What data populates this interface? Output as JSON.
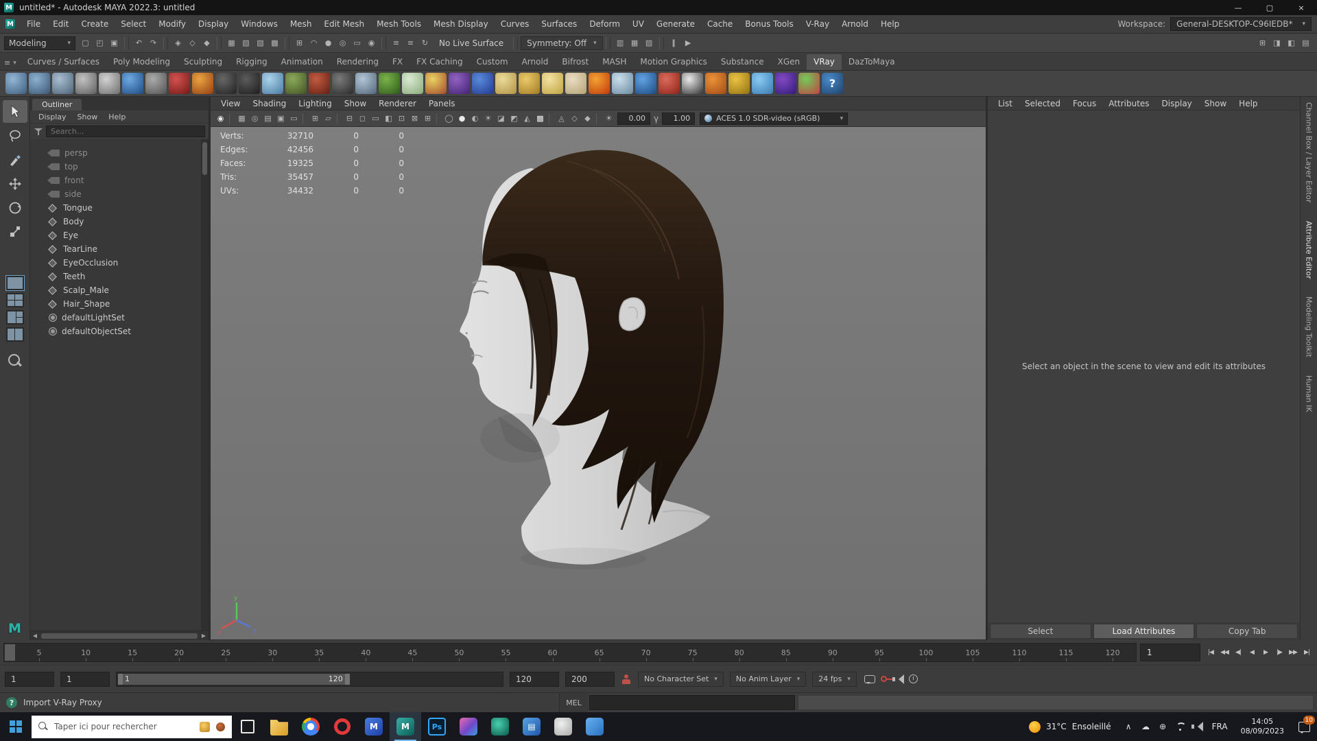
{
  "theme": {
    "accent": "#5285a6",
    "viewport_bg": "#787878",
    "hair_color": "#261b10",
    "skin_color": "#d6d6d6",
    "taskbar_bg": "#16181d"
  },
  "glyphs": {
    "caret": "▾",
    "menu": "≡",
    "gamma": "γ",
    "pause": "∥"
  },
  "titlebar": {
    "title": "untitled* - Autodesk MAYA 2022.3: untitled",
    "min": "—",
    "max": "▢",
    "close": "×"
  },
  "menubar": {
    "items": [
      "File",
      "Edit",
      "Create",
      "Select",
      "Modify",
      "Display",
      "Windows",
      "Mesh",
      "Edit Mesh",
      "Mesh Tools",
      "Mesh Display",
      "Curves",
      "Surfaces",
      "Deform",
      "UV",
      "Generate",
      "Cache",
      "Bonus Tools",
      "V-Ray",
      "Arnold",
      "Help"
    ],
    "workspace_label": "Workspace:",
    "workspace": "General-DESKTOP-C96IEDB*"
  },
  "statusline": {
    "mode": "Modeling",
    "live_surface": "No Live Surface",
    "symmetry": "Symmetry: Off",
    "icons": [
      {
        "cls": "sl-icon",
        "name": "new-scene-icon",
        "g": "▢"
      },
      {
        "cls": "sl-icon",
        "name": "open-scene-icon",
        "g": "◰"
      },
      {
        "cls": "sl-icon",
        "name": "save-scene-icon",
        "g": "▣"
      },
      {
        "cls": "sl-sep",
        "name": "separator",
        "g": ""
      },
      {
        "cls": "sl-icon",
        "name": "undo-icon",
        "g": "↶"
      },
      {
        "cls": "sl-icon",
        "name": "redo-icon",
        "g": "↷"
      },
      {
        "cls": "sl-sep",
        "name": "separator",
        "g": ""
      },
      {
        "cls": "sl-icon",
        "name": "select-by-hierarchy-icon",
        "g": "◈"
      },
      {
        "cls": "sl-icon",
        "name": "select-by-object-icon",
        "g": "◇"
      },
      {
        "cls": "sl-icon",
        "name": "select-by-component-icon",
        "g": "◆"
      },
      {
        "cls": "sl-sep",
        "name": "separator",
        "g": ""
      },
      {
        "cls": "sl-icon",
        "name": "mask-handles-icon",
        "g": "▦"
      },
      {
        "cls": "sl-icon",
        "name": "mask-joints-icon",
        "g": "▧"
      },
      {
        "cls": "sl-icon",
        "name": "mask-curves-icon",
        "g": "▨"
      },
      {
        "cls": "sl-icon",
        "name": "mask-surfaces-icon",
        "g": "▩"
      },
      {
        "cls": "sl-sep",
        "name": "separator",
        "g": ""
      },
      {
        "cls": "sl-icon",
        "name": "snap-to-grid-icon",
        "g": "⊞"
      },
      {
        "cls": "sl-icon",
        "name": "snap-to-curve-icon",
        "g": "◠"
      },
      {
        "cls": "sl-icon",
        "name": "snap-to-point-icon",
        "g": "●"
      },
      {
        "cls": "sl-icon",
        "name": "snap-to-projected-center-icon",
        "g": "◎"
      },
      {
        "cls": "sl-icon",
        "name": "snap-to-view-plane-icon",
        "g": "▭"
      },
      {
        "cls": "sl-icon",
        "name": "make-live-icon",
        "g": "◉"
      },
      {
        "cls": "sl-sep",
        "name": "separator",
        "g": ""
      },
      {
        "cls": "sl-icon",
        "name": "input-connections-icon",
        "g": "≡"
      },
      {
        "cls": "sl-icon",
        "name": "output-connections-icon",
        "g": "≡"
      },
      {
        "cls": "sl-icon",
        "name": "construction-history-icon",
        "g": "↻"
      }
    ],
    "icons2": [
      {
        "cls": "sl-icon",
        "name": "render-current-frame-icon",
        "g": "▥"
      },
      {
        "cls": "sl-icon",
        "name": "ipr-render-icon",
        "g": "▦"
      },
      {
        "cls": "sl-icon",
        "name": "render-settings-icon",
        "g": "▧"
      },
      {
        "cls": "sl-sep",
        "name": "separator",
        "g": ""
      },
      {
        "cls": "sl-icon pause",
        "name": "pause-evaluation-icon",
        "g": "∥"
      },
      {
        "cls": "sl-icon",
        "name": "resume-evaluation-icon",
        "g": "▶"
      }
    ],
    "right_icons": [
      {
        "cls": "sl-icon",
        "name": "toggle-modeling-toolkit-icon",
        "g": "⊞"
      },
      {
        "cls": "sl-icon",
        "name": "toggle-attribute-editor-icon",
        "g": "◨"
      },
      {
        "cls": "sl-icon",
        "name": "toggle-tool-settings-icon",
        "g": "◧"
      },
      {
        "cls": "sl-icon",
        "name": "toggle-channel-box-icon",
        "g": "▤"
      }
    ]
  },
  "shelf": {
    "tabs": [
      {
        "label": "Curves / Surfaces"
      },
      {
        "label": "Poly Modeling"
      },
      {
        "label": "Sculpting"
      },
      {
        "label": "Rigging"
      },
      {
        "label": "Animation"
      },
      {
        "label": "Rendering"
      },
      {
        "label": "FX"
      },
      {
        "label": "FX Caching"
      },
      {
        "label": "Custom"
      },
      {
        "label": "Arnold"
      },
      {
        "label": "Bifrost"
      },
      {
        "label": "MASH"
      },
      {
        "label": "Motion Graphics"
      },
      {
        "label": "Substance"
      },
      {
        "label": "XGen"
      },
      {
        "label": "VRay",
        "active": true
      },
      {
        "label": "DazToMaya"
      }
    ],
    "icons": [
      {
        "css": "--c1:#93b7d6;--c2:#3e5d7d",
        "name": "poly-tool-icon-1"
      },
      {
        "css": "--c1:#8db1d0;--c2:#3a5674",
        "name": "poly-tool-icon-2"
      },
      {
        "css": "--c1:#a9bfd0;--c2:#4c6378",
        "name": "plane-tool-icon"
      },
      {
        "css": "--c1:#c2c2c2;--c2:#5e5e5e",
        "name": "measure-tool-icon"
      },
      {
        "css": "--c1:#d2d2d2;--c2:#6e6e6e",
        "name": "notes-icon"
      },
      {
        "css": "--c1:#6fa9e1;--c2:#1d4b81",
        "name": "sphere-blue-icon"
      },
      {
        "css": "--c1:#ababab;--c2:#525252",
        "name": "sphere-gray-icon"
      },
      {
        "css": "--c1:#d25250;--c2:#721915",
        "name": "sphere-red-icon"
      },
      {
        "css": "--c1:#eaa342;--c2:#924112",
        "name": "sphere-orange-icon"
      },
      {
        "css": "--c1:#676767;--c2:#212121",
        "name": "checker-sphere-icon"
      },
      {
        "css": "--c1:#5b5b5b;--c2:#1d1d1d",
        "name": "dark-sphere-icon"
      },
      {
        "css": "--c1:#abd3ea;--c2:#4a7aa2",
        "name": "glass-sphere-icon"
      },
      {
        "css": "--c1:#8aaa5a;--c2:#425222",
        "name": "textured-sphere-icon"
      },
      {
        "css": "--c1:#c25a42;--c2:#621f12",
        "name": "checker-red-icon"
      },
      {
        "css": "--c1:#7a7a7a;--c2:#2a2a2a",
        "name": "swirl-sphere-icon"
      },
      {
        "css": "--c1:#b2c6d6;--c2:#52667a",
        "name": "checker-plane-icon"
      },
      {
        "css": "--c1:#7ab24a;--c2:#2e5a1a",
        "name": "fur-grass-icon"
      },
      {
        "css": "--c1:#daead2;--c2:#8aaa7a",
        "name": "scatter-icon"
      },
      {
        "css": "--c1:#ead262;--c2:#a24a2a",
        "name": "fireworks-icon"
      },
      {
        "css": "--c1:#9262c2;--c2:#422272",
        "name": "swirl-purple-icon"
      },
      {
        "css": "--c1:#5a8ada;--c2:#223a92",
        "name": "sphere-deep-blue-icon"
      },
      {
        "css": "--c1:#eada9a;--c2:#b29242",
        "name": "dome-light-icon"
      },
      {
        "css": "--c1:#eaca6a;--c2:#a27a22",
        "name": "funnel-icon"
      },
      {
        "css": "--c1:#f2e2a2;--c2:#c2a242",
        "name": "sphere-light-icon"
      },
      {
        "css": "--c1:#eaddc2;--c2:#b2a272",
        "name": "cone-icon"
      },
      {
        "css": "--c1:#f2a232;--c2:#c23a0a",
        "name": "sun-light-icon"
      },
      {
        "css": "--c1:#cadeea;--c2:#6a8aa2",
        "name": "glass-pane-icon"
      },
      {
        "css": "--c1:#62a2e2;--c2:#1a4a82",
        "name": "gloss-blue-sphere-icon"
      },
      {
        "css": "--c1:#da6a5a;--c2:#8e221a",
        "name": "column-icon"
      },
      {
        "css": "--c1:#eaeaea;--c2:#323232",
        "name": "checker-cube-icon"
      },
      {
        "css": "--c1:#ea923a;--c2:#a24a12",
        "name": "clapperboard-icon"
      },
      {
        "css": "--c1:#eac242;--c2:#927212",
        "name": "clamp-tool-icon"
      },
      {
        "css": "--c1:#8acaf2;--c2:#3a7ab2",
        "name": "cloud-icon"
      },
      {
        "css": "--c1:#8249c2;--c2:#321a7a",
        "name": "vray-orb-icon"
      },
      {
        "css": "--c1:#72ca5a;--c2:#c24242",
        "name": "multi-color-icon"
      },
      {
        "css": "--c1:#4a8aca;--c2:#1d426a",
        "name": "help-icon",
        "g": "?"
      }
    ]
  },
  "toolbox": {
    "tools": [
      "select-tool",
      "lasso-tool",
      "paint-select-tool",
      "move-tool",
      "rotate-tool",
      "scale-tool"
    ],
    "layouts": [
      "layout-single-pane",
      "layout-four-panes",
      "layout-persp-outliner",
      "layout-two-panes"
    ],
    "other": [
      "zoom-tool",
      "maya-logo"
    ]
  },
  "outliner": {
    "title": "Outliner",
    "menus": [
      "Display",
      "Show",
      "Help"
    ],
    "search_placeholder": "Search...",
    "items": [
      {
        "label": "persp",
        "icls": "oicon cam",
        "rcls": "orow dim"
      },
      {
        "label": "top",
        "icls": "oicon cam",
        "rcls": "orow dim"
      },
      {
        "label": "front",
        "icls": "oicon cam",
        "rcls": "orow dim"
      },
      {
        "label": "side",
        "icls": "oicon cam",
        "rcls": "orow dim"
      },
      {
        "label": "Tongue",
        "icls": "oicon mesh",
        "rcls": "orow"
      },
      {
        "label": "Body",
        "icls": "oicon mesh",
        "rcls": "orow"
      },
      {
        "label": "Eye",
        "icls": "oicon mesh",
        "rcls": "orow"
      },
      {
        "label": "TearLine",
        "icls": "oicon mesh",
        "rcls": "orow"
      },
      {
        "label": "EyeOcclusion",
        "icls": "oicon mesh",
        "rcls": "orow"
      },
      {
        "label": "Teeth",
        "icls": "oicon mesh",
        "rcls": "orow"
      },
      {
        "label": "Scalp_Male",
        "icls": "oicon mesh",
        "rcls": "orow"
      },
      {
        "label": "Hair_Shape",
        "icls": "oicon mesh",
        "rcls": "orow"
      },
      {
        "label": "defaultLightSet",
        "icls": "oicon set",
        "rcls": "orow"
      },
      {
        "label": "defaultObjectSet",
        "icls": "oicon set",
        "rcls": "orow"
      }
    ]
  },
  "viewport": {
    "menus": [
      "View",
      "Shading",
      "Lighting",
      "Show",
      "Renderer",
      "Panels"
    ],
    "toolbar": [
      {
        "cls": "vp-icon on",
        "name": "renderer-indicator-icon",
        "g": "◉"
      },
      {
        "cls": "vp-sep",
        "name": "separator",
        "g": ""
      },
      {
        "cls": "vp-icon",
        "name": "select-camera-icon",
        "g": "▦"
      },
      {
        "cls": "vp-icon",
        "name": "lock-camera-icon",
        "g": "◎"
      },
      {
        "cls": "vp-icon",
        "name": "camera-attributes-icon",
        "g": "▤"
      },
      {
        "cls": "vp-icon",
        "name": "bookmarks-icon",
        "g": "▣"
      },
      {
        "cls": "vp-icon",
        "name": "image-plane-icon",
        "g": "▭"
      },
      {
        "cls": "vp-sep",
        "name": "separator",
        "g": ""
      },
      {
        "cls": "vp-icon",
        "name": "2d-pan-zoom-icon",
        "g": "⊞"
      },
      {
        "cls": "vp-icon",
        "name": "grease-pencil-icon",
        "g": "▱"
      },
      {
        "cls": "vp-sep",
        "name": "separator",
        "g": ""
      },
      {
        "cls": "vp-icon",
        "name": "grid-icon",
        "g": "⊟"
      },
      {
        "cls": "vp-icon",
        "name": "film-gate-icon",
        "g": "◻"
      },
      {
        "cls": "vp-icon",
        "name": "resolution-gate-icon",
        "g": "▭"
      },
      {
        "cls": "vp-icon",
        "name": "gate-mask-icon",
        "g": "◧"
      },
      {
        "cls": "vp-icon",
        "name": "field-chart-icon",
        "g": "⊡"
      },
      {
        "cls": "vp-icon",
        "name": "safe-action-icon",
        "g": "⊠"
      },
      {
        "cls": "vp-icon",
        "name": "safe-title-icon",
        "g": "⊞"
      },
      {
        "cls": "vp-sep",
        "name": "separator",
        "g": ""
      },
      {
        "cls": "vp-icon",
        "name": "wireframe-icon",
        "g": "◯"
      },
      {
        "cls": "vp-icon on",
        "name": "smooth-shade-icon",
        "g": "●"
      },
      {
        "cls": "vp-icon",
        "name": "textured-icon",
        "g": "◐"
      },
      {
        "cls": "vp-icon",
        "name": "use-all-lights-icon",
        "g": "☀"
      },
      {
        "cls": "vp-icon",
        "name": "shadows-icon",
        "g": "◪"
      },
      {
        "cls": "vp-icon",
        "name": "screen-space-ao-icon",
        "g": "◩"
      },
      {
        "cls": "vp-icon",
        "name": "motion-blur-icon",
        "g": "◭"
      },
      {
        "cls": "vp-icon on",
        "name": "anti-aliasing-icon",
        "g": "▩"
      },
      {
        "cls": "vp-sep",
        "name": "separator",
        "g": ""
      },
      {
        "cls": "vp-icon",
        "name": "isolate-select-icon",
        "g": "◬"
      },
      {
        "cls": "vp-icon",
        "name": "xray-icon",
        "g": "◇"
      },
      {
        "cls": "vp-icon",
        "name": "xray-joints-icon",
        "g": "◆"
      },
      {
        "cls": "vp-sep",
        "name": "separator",
        "g": ""
      },
      {
        "cls": "vp-icon",
        "name": "exposure-icon",
        "g": "☀"
      }
    ],
    "exposure": "0.00",
    "gamma": "1.00",
    "colorspace": "ACES 1.0 SDR-video (sRGB)",
    "hud": {
      "rows": [
        {
          "label": "Verts:",
          "total": "32710",
          "a": "0",
          "b": "0"
        },
        {
          "label": "Edges:",
          "total": "42456",
          "a": "0",
          "b": "0"
        },
        {
          "label": "Faces:",
          "total": "19325",
          "a": "0",
          "b": "0"
        },
        {
          "label": "Tris:",
          "total": "35457",
          "a": "0",
          "b": "0"
        },
        {
          "label": "UVs:",
          "total": "34432",
          "a": "0",
          "b": "0"
        }
      ]
    }
  },
  "attribute_editor": {
    "menus": [
      "List",
      "Selected",
      "Focus",
      "Attributes",
      "Display",
      "Show",
      "Help"
    ],
    "message": "Select an object in the scene to view and edit its attributes",
    "buttons": [
      {
        "label": "Select"
      },
      {
        "label": "Load Attributes",
        "active": true
      },
      {
        "label": "Copy Tab"
      }
    ]
  },
  "right_tabs": {
    "items": [
      {
        "label": "Channel Box / Layer Editor"
      },
      {
        "label": "Attribute Editor",
        "active": true
      },
      {
        "label": "Modeling Toolkit"
      },
      {
        "label": "Human IK"
      }
    ]
  },
  "timeline": {
    "ticks": [
      "5",
      "10",
      "15",
      "20",
      "25",
      "30",
      "35",
      "40",
      "45",
      "50",
      "55",
      "60",
      "65",
      "70",
      "75",
      "80",
      "85",
      "90",
      "95",
      "100",
      "105",
      "110",
      "115",
      "120"
    ],
    "frame_field": "1",
    "playback": [
      {
        "name": "go-to-start-button",
        "g": "|◀"
      },
      {
        "name": "step-back-key-button",
        "g": "◀◀"
      },
      {
        "name": "step-back-frame-button",
        "g": "◀|"
      },
      {
        "name": "play-backwards-button",
        "g": "◀"
      },
      {
        "name": "play-forwards-button",
        "g": "▶"
      },
      {
        "name": "step-forward-frame-button",
        "g": "|▶"
      },
      {
        "name": "step-forward-key-button",
        "g": "▶▶"
      },
      {
        "name": "go-to-end-button",
        "g": "▶|"
      }
    ]
  },
  "range": {
    "anim_start": "1",
    "play_start": "1",
    "bar_start_label": "1",
    "bar_end_label": "120",
    "play_end": "120",
    "anim_end": "200",
    "character_set": "No Character Set",
    "anim_layer": "No Anim Layer",
    "fps": "24 fps"
  },
  "command_line": {
    "help_text": "Import V-Ray Proxy",
    "mel_label": "MEL",
    "input_value": ""
  },
  "taskbar": {
    "search_placeholder": "Taper ici pour rechercher",
    "search_icons": [
      "search-magnifier-icon",
      "rewards-trophy-icon",
      "sports-ball-icon"
    ],
    "apps": [
      {
        "name": "task-view-icon",
        "cls": "app-icon taskview",
        "g": ""
      },
      {
        "name": "file-explorer-icon",
        "cls": "app-icon explorer",
        "css": "--bg:linear-gradient(135deg,#f8d775,#d79b28)",
        "g": ""
      },
      {
        "name": "chrome-icon",
        "cls": "app-icon chrome",
        "g": ""
      },
      {
        "name": "opera-icon",
        "cls": "app-icon opera",
        "g": ""
      },
      {
        "name": "app-m-blue-icon",
        "cls": "app-icon",
        "css": "--bg:linear-gradient(135deg,#4a7de0,#1c3fa8)",
        "g": "M"
      },
      {
        "name": "maya-icon",
        "cls": "app-icon",
        "css": "--bg:linear-gradient(135deg,#37b0a5,#0b5e57)",
        "g": "M",
        "active": true
      },
      {
        "name": "photoshop-icon",
        "cls": "app-icon ps",
        "g": "Ps"
      },
      {
        "name": "premiere-icon",
        "cls": "app-icon",
        "css": "--bg:linear-gradient(135deg,#e86ab0,#7048c8 55%,#38a0e0)",
        "g": ""
      },
      {
        "name": "teal-swirl-app-icon",
        "cls": "app-icon",
        "css": "--bg:radial-gradient(circle at 40% 35%,#48d0b0,#0a5848)",
        "g": ""
      },
      {
        "name": "calculator-icon",
        "cls": "app-icon",
        "css": "--bg:linear-gradient(135deg,#58a0e8,#2058a8)",
        "g": "▤"
      },
      {
        "name": "game-controller-icon",
        "cls": "app-icon",
        "css": "--bg:radial-gradient(circle at 40% 35%,#f0f0f0,#a8a8a8)",
        "g": ""
      },
      {
        "name": "app-blue-icon",
        "cls": "app-icon",
        "css": "--bg:linear-gradient(135deg,#68b0f0,#2870c0)",
        "g": ""
      }
    ],
    "tray": {
      "weather_temp": "31°C",
      "weather_desc": "Ensoleillé",
      "chevron": "∧",
      "lang": "FRA",
      "time": "14:05",
      "date": "08/09/2023",
      "badge": "10",
      "icons": [
        "hidden-icons-chevron",
        "onedrive-cloud-icon",
        "network-icon",
        "wifi-icon",
        "volume-icon"
      ]
    }
  }
}
